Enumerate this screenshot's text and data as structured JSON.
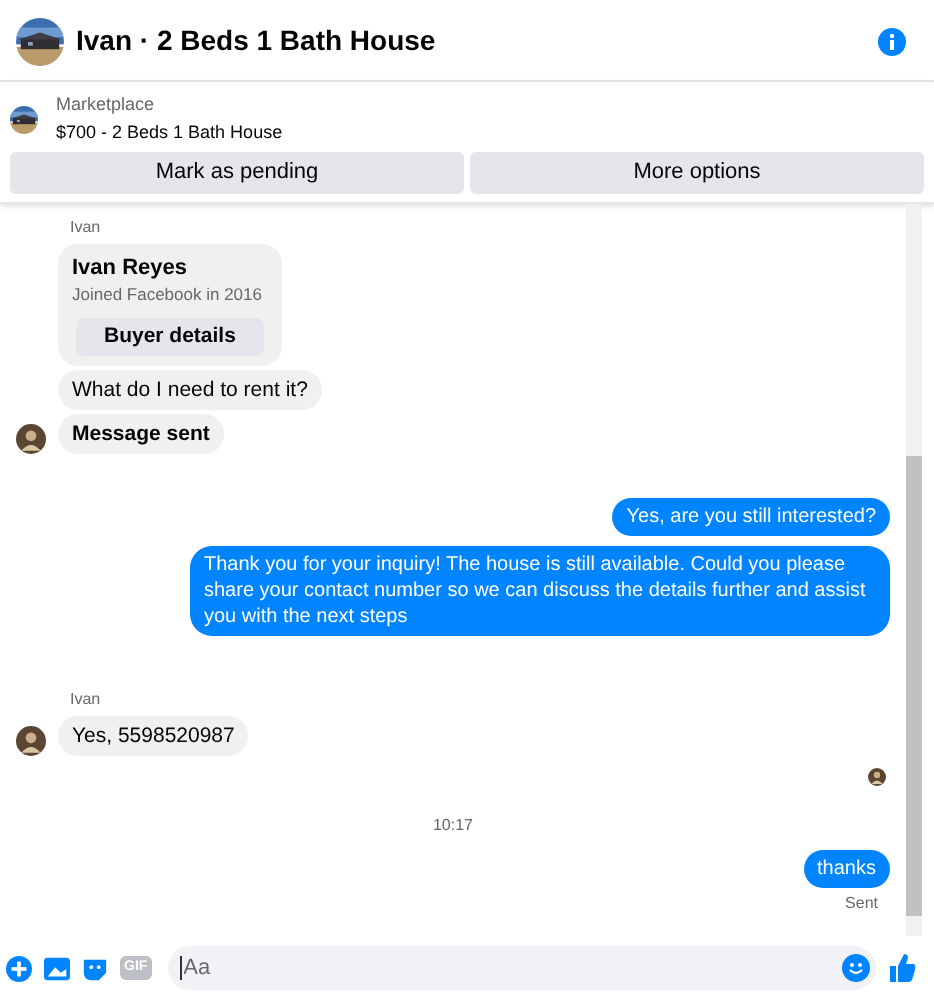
{
  "header": {
    "title": "Ivan · 2 Beds 1 Bath House"
  },
  "listing": {
    "category": "Marketplace",
    "title": "$700 - 2 Beds 1 Bath House",
    "buttons": [
      "Mark as pending",
      "More options"
    ]
  },
  "messages": [
    {
      "kind": "sender",
      "text": "Ivan"
    },
    {
      "kind": "card",
      "name": "Ivan Reyes",
      "subtitle": "Joined Facebook in 2016",
      "button": "Buyer details"
    },
    {
      "kind": "incoming",
      "text": "What do I need to rent it?",
      "avatar": false
    },
    {
      "kind": "incoming",
      "text": "Message sent",
      "avatar": true,
      "bold": true
    },
    {
      "kind": "outgoing",
      "text": "Yes, are you still interested?"
    },
    {
      "kind": "outgoing",
      "text": "Thank you for your inquiry! The house is still available. Could you please share your contact number so we can discuss the details further and assist you with the next steps"
    },
    {
      "kind": "sender",
      "text": "Ivan"
    },
    {
      "kind": "incoming",
      "text": "Yes, 5598520987",
      "avatar": true,
      "bold": false
    },
    {
      "kind": "seen"
    },
    {
      "kind": "time",
      "text": "10:17"
    },
    {
      "kind": "outgoing",
      "text": "thanks"
    },
    {
      "kind": "status",
      "text": "Sent"
    }
  ],
  "composer": {
    "gif": "GIF",
    "placeholder": "Aa"
  }
}
